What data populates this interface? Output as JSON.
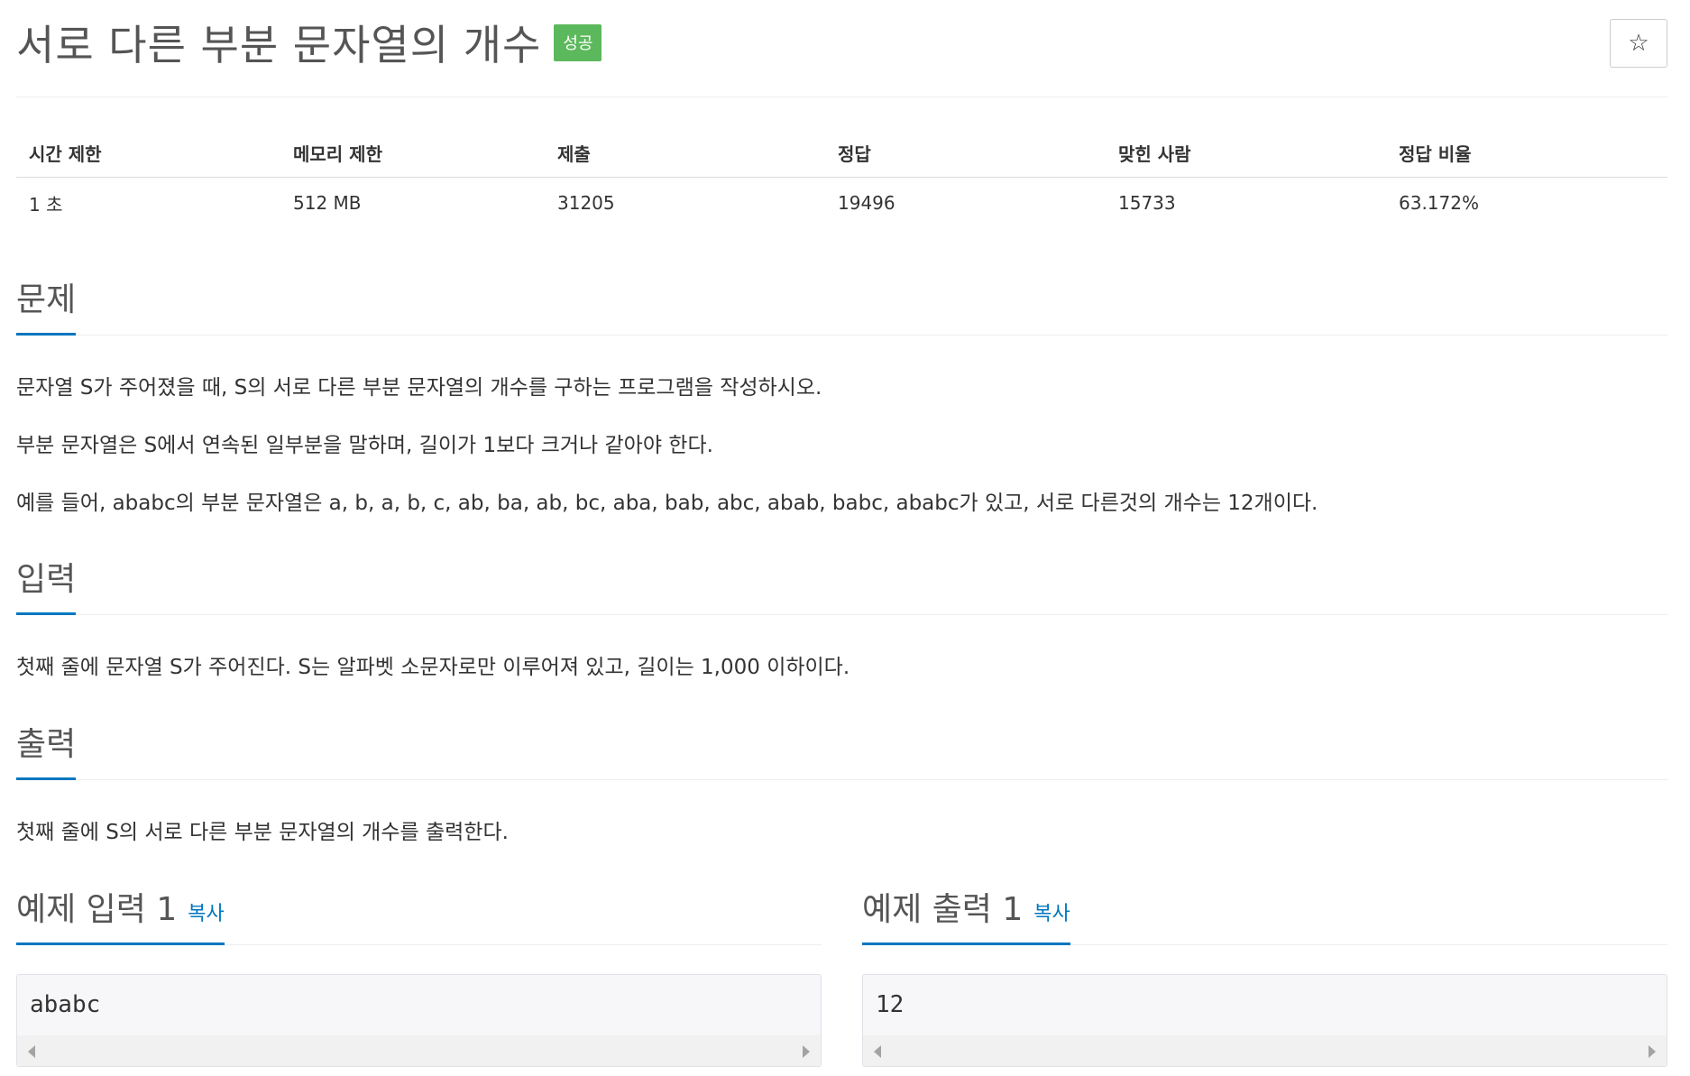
{
  "problem": {
    "title": "서로 다른 부분 문자열의 개수",
    "status_badge": "성공",
    "star_icon": "☆"
  },
  "info_table": {
    "headers": [
      "시간 제한",
      "메모리 제한",
      "제출",
      "정답",
      "맞힌 사람",
      "정답 비율"
    ],
    "values": [
      "1 초",
      "512 MB",
      "31205",
      "19496",
      "15733",
      "63.172%"
    ]
  },
  "sections": {
    "description": {
      "heading": "문제",
      "paragraphs": [
        "문자열 S가 주어졌을 때, S의 서로 다른 부분 문자열의 개수를 구하는 프로그램을 작성하시오.",
        "부분 문자열은 S에서 연속된 일부분을 말하며, 길이가 1보다 크거나 같아야 한다.",
        "예를 들어, ababc의 부분 문자열은 a, b, a, b, c, ab, ba, ab, bc, aba, bab, abc, abab, babc, ababc가 있고, 서로 다른것의 개수는 12개이다."
      ]
    },
    "input": {
      "heading": "입력",
      "text": "첫째 줄에 문자열 S가 주어진다. S는 알파벳 소문자로만 이루어져 있고, 길이는 1,000 이하이다."
    },
    "output": {
      "heading": "출력",
      "text": "첫째 줄에 S의 서로 다른 부분 문자열의 개수를 출력한다."
    },
    "sample_input": {
      "heading": "예제 입력 1",
      "copy_label": "복사",
      "content": "ababc"
    },
    "sample_output": {
      "heading": "예제 출력 1",
      "copy_label": "복사",
      "content": "12"
    }
  }
}
